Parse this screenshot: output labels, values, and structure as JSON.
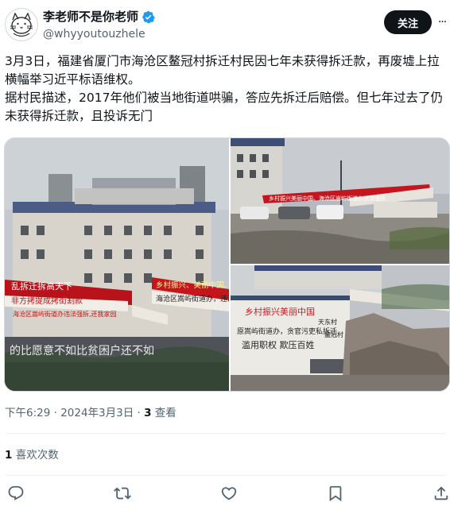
{
  "author": {
    "display_name": "李老师不是你老师",
    "handle": "@whyyoutouzhele",
    "verified": true,
    "follow_label": "关注",
    "more_label": "···"
  },
  "tweet": {
    "text": "3月3日，福建省厦门市海沧区鳌冠村拆迁村民因七年未获得拆迁款，再废墟上拉横幅举习近平标语维权。\n据村民描述，2017年他们被当地街道哄骗，答应先拆迁后赔偿。但七年过去了仍未获得拆迁款，且投诉无门",
    "media": [
      {
        "alt": "",
        "banners": [
          "乡村振兴、美丽中国、",
          "海沧区嵩屿街道办，违法",
          "乱拆迁拆高天下",
          "非方拷提成拷街割款",
          "海沧区嵩屿街道办违法强拆,还我家园"
        ],
        "wall_text": "的比愿意不如比贫困户还不如"
      },
      {
        "alt": "",
        "banners": [
          "乡村振兴美丽中国、海沧区嵩屿街道办违法强拆",
          "违法强拆 乱拆迁 还我家园"
        ]
      },
      {
        "alt": "",
        "banners": [
          "乡村振兴美丽中国",
          "天东村",
          "鳌冠村",
          "原嵩屿街道办，贪官污吏私拆迁",
          "滥用职权 欺压百姓"
        ]
      }
    ]
  },
  "meta": {
    "time": "下午6:29 · 2024年3月3日",
    "separator": " · ",
    "views_count": "3",
    "views_label": " 查看"
  },
  "likes": {
    "count": "1",
    "label": " 喜欢次数"
  },
  "actions": {
    "reply_icon": "reply-icon",
    "retweet_icon": "retweet-icon",
    "like_icon": "heart-icon",
    "bookmark_icon": "bookmark-icon",
    "share_icon": "share-icon"
  },
  "colors": {
    "text": "#0f1419",
    "secondary": "#536471",
    "verified": "#1d9bf0",
    "button_bg": "#0f1419",
    "divider": "#eff3f4"
  }
}
